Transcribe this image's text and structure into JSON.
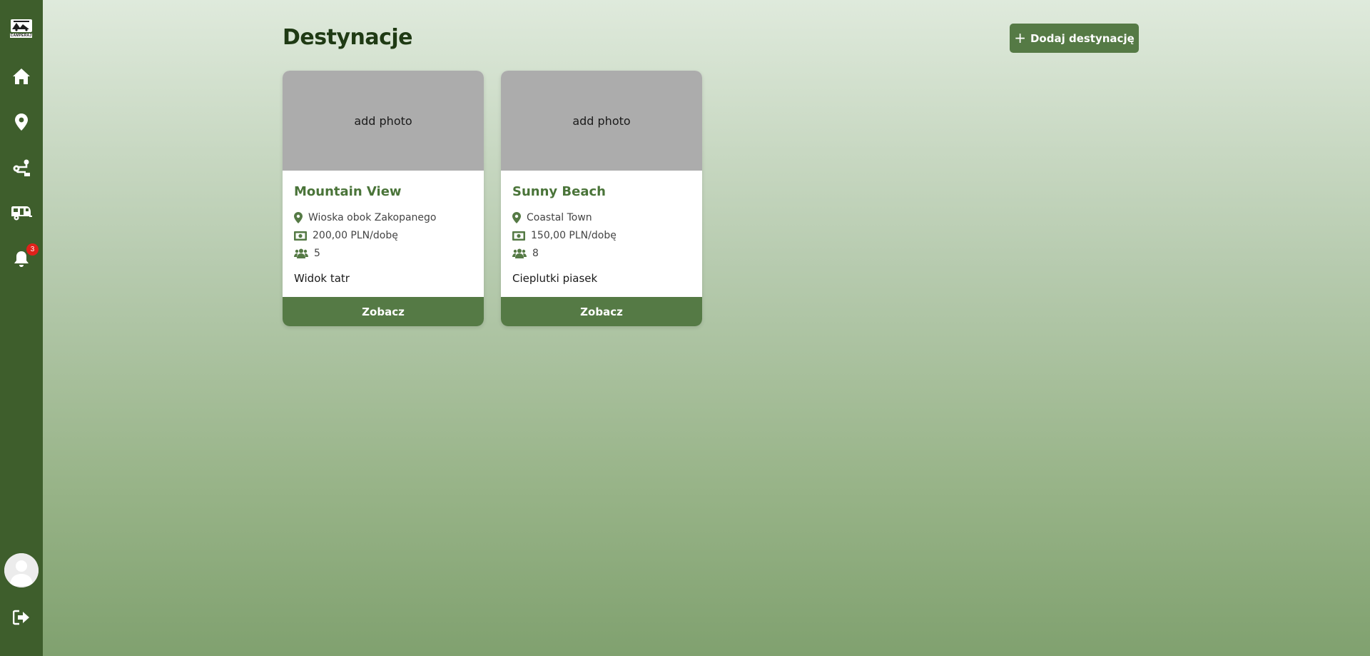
{
  "sidebar": {
    "logo_text": "CAMPERAJ",
    "items": [
      {
        "name": "home",
        "icon": "home-icon"
      },
      {
        "name": "destinations",
        "icon": "map-pin-icon"
      },
      {
        "name": "routes",
        "icon": "route-icon"
      },
      {
        "name": "campers",
        "icon": "caravan-icon"
      },
      {
        "name": "notifications",
        "icon": "bell-icon",
        "badge": "3"
      }
    ],
    "avatar_icon": "user-avatar-icon",
    "logout_icon": "logout-icon"
  },
  "page": {
    "title": "Destynacje",
    "add_button": {
      "plus": "+",
      "label": "Dodaj destynację"
    }
  },
  "cards": [
    {
      "photo_label": "add photo",
      "name": "Mountain View",
      "location": "Wioska obok Zakopanego",
      "price": "200,00 PLN/dobę",
      "capacity": "5",
      "description": "Widok tatr",
      "button": "Zobacz"
    },
    {
      "photo_label": "add photo",
      "name": "Sunny Beach",
      "location": "Coastal Town",
      "price": "150,00 PLN/dobę",
      "capacity": "8",
      "description": "Cieplutki piasek",
      "button": "Zobacz"
    }
  ],
  "colors": {
    "sidebar": "#3e5e2c",
    "accent": "#557a45",
    "title": "#1f3a14",
    "card_name": "#4a7439",
    "badge": "#e0211b"
  }
}
